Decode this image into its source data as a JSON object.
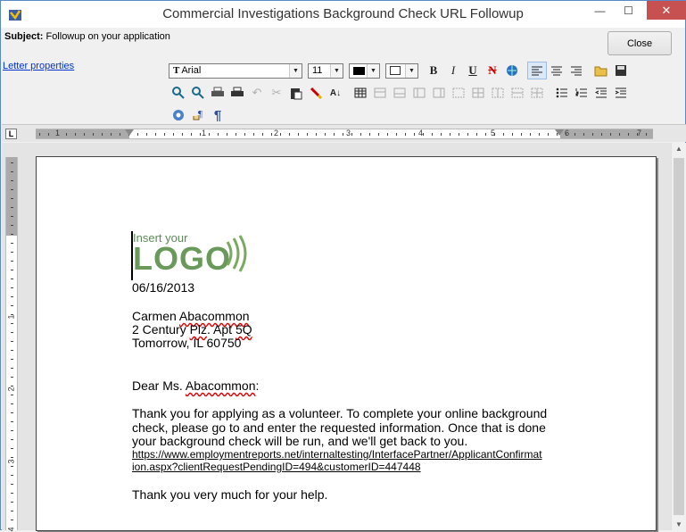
{
  "window": {
    "title": "Commercial Investigations Background Check URL Followup",
    "min_glyph": "—",
    "max_glyph": "☐",
    "close_glyph": "✕"
  },
  "header": {
    "subject_label": "Subject:",
    "subject_value": "Followup on your application",
    "close_label": "Close",
    "letter_properties_label": "Letter properties"
  },
  "toolbar": {
    "font_name": "Arial",
    "font_size": "11",
    "bold": "B",
    "italic": "I",
    "underline": "U",
    "strike": "N"
  },
  "ruler": {
    "corner": "L",
    "h_labels": [
      "1",
      "1",
      "2",
      "3",
      "4",
      "5",
      "6",
      "7"
    ],
    "v_labels": [
      "1",
      "2",
      "3",
      "4"
    ]
  },
  "document": {
    "logo_small": "Insert your",
    "logo_big": "LOGO",
    "date": "06/16/2013",
    "name_first": "Carmen ",
    "name_last": "Abacommon",
    "addr_prefix": "2 Century ",
    "addr_plz": "Plz",
    "addr_mid": ". Apt ",
    "addr_apt": "5Q",
    "city": "Tomorrow, IL 60750",
    "greeting_prefix": "Dear Ms. ",
    "greeting_name": "Abacommon",
    "greeting_suffix": ":",
    "para1_line1": "Thank you for applying as a volunteer. To complete your online background",
    "para1_line2": "check, please go to  and enter the requested information. Once that is done",
    "para1_line3": "your background check will be run, and we'll get back to you.",
    "url_line1": "https://www.employmentreports.net/internaltesting/InterfacePartner/ApplicantConfirmat",
    "url_line2": "ion.aspx?clientRequestPendingID=494&customerID=447448",
    "closing": "Thank you very much for your help."
  }
}
